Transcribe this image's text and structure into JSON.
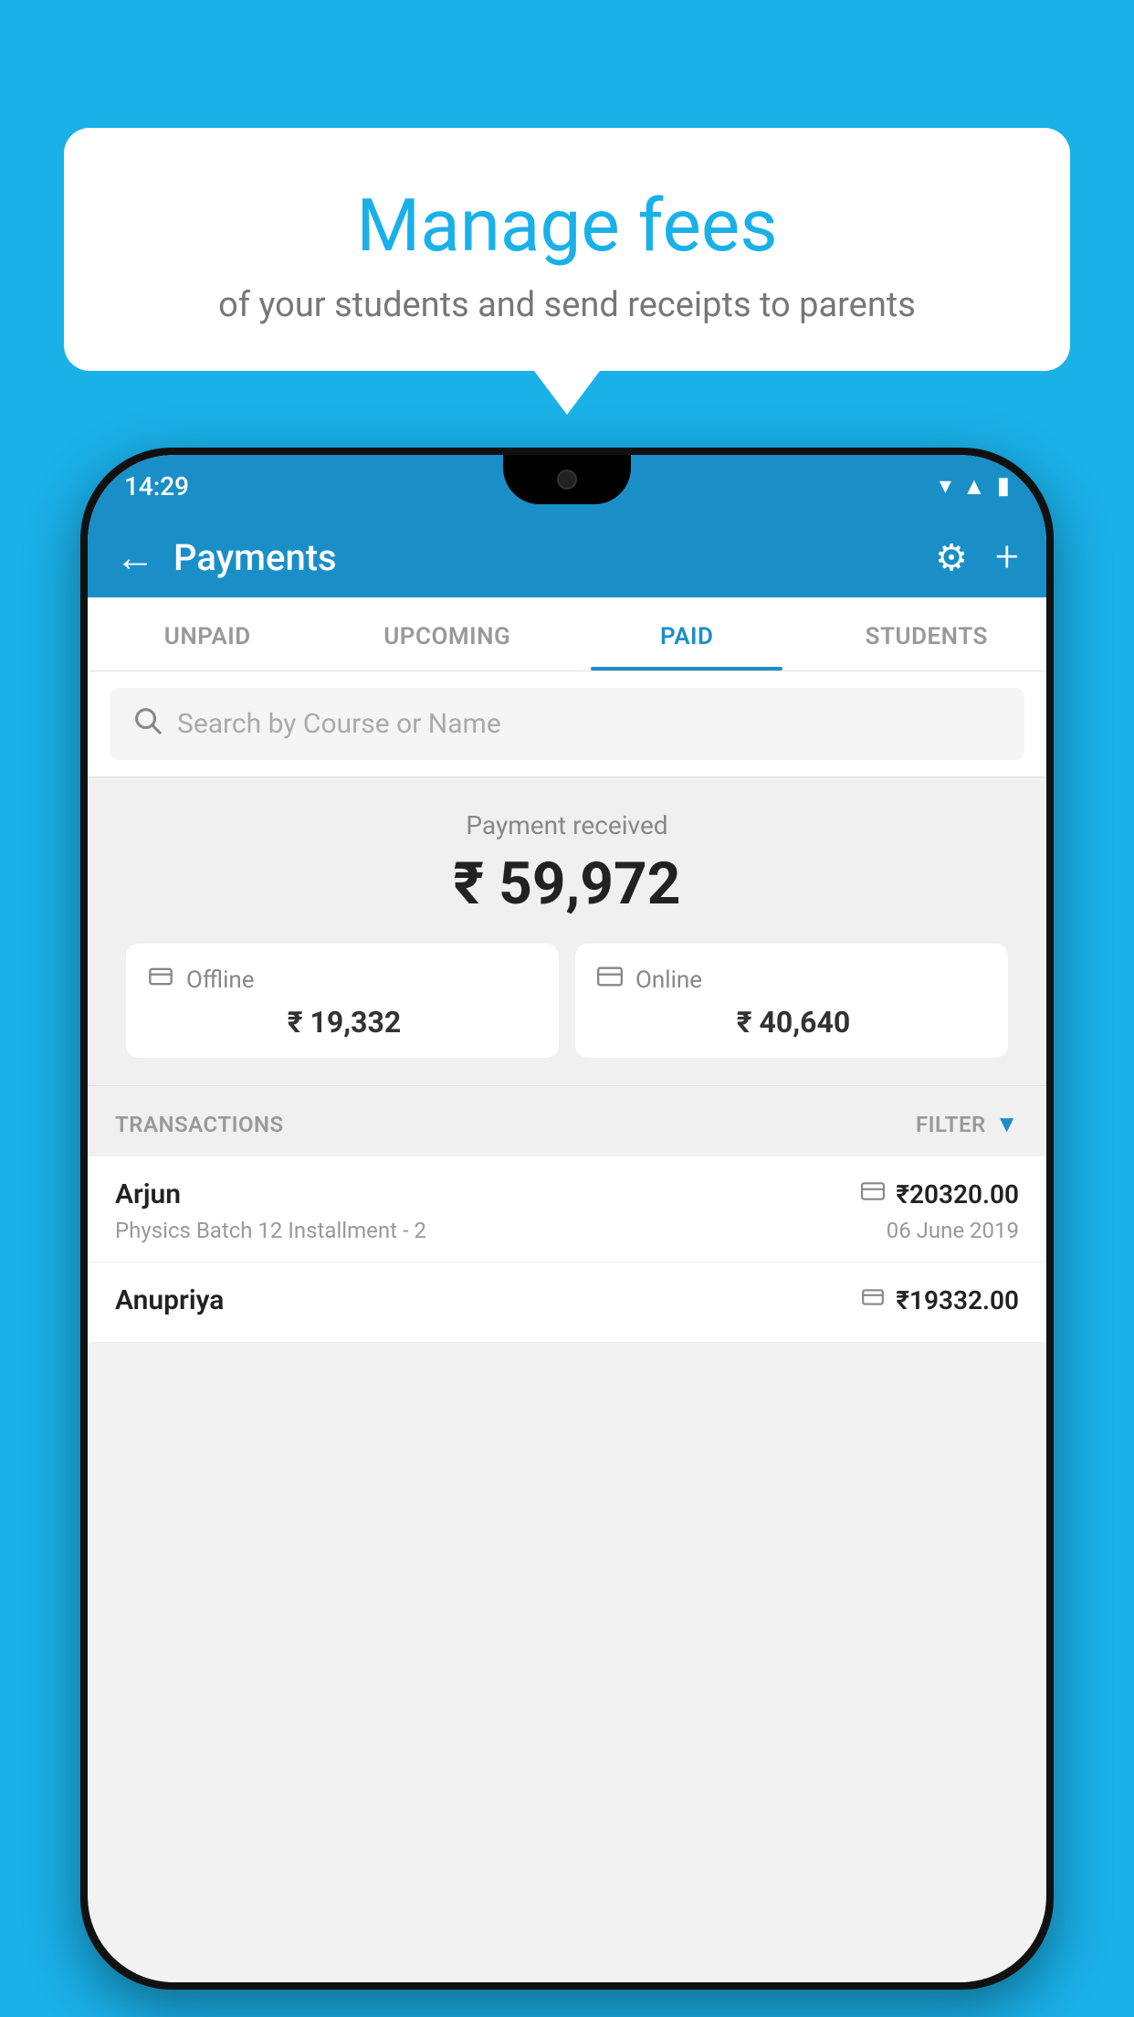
{
  "background_color": "#1ab0e8",
  "speech_bubble": {
    "title": "Manage fees",
    "subtitle": "of your students and send receipts to parents"
  },
  "status_bar": {
    "time": "14:29",
    "icons": [
      "wifi",
      "signal",
      "battery"
    ]
  },
  "top_bar": {
    "back_label": "←",
    "title": "Payments",
    "gear_label": "⚙",
    "plus_label": "+"
  },
  "tabs": [
    {
      "label": "UNPAID",
      "active": false
    },
    {
      "label": "UPCOMING",
      "active": false
    },
    {
      "label": "PAID",
      "active": true
    },
    {
      "label": "STUDENTS",
      "active": false
    }
  ],
  "search": {
    "placeholder": "Search by Course or Name"
  },
  "payment_summary": {
    "label": "Payment received",
    "amount": "₹ 59,972",
    "offline": {
      "icon": "💳",
      "label": "Offline",
      "amount": "₹ 19,332"
    },
    "online": {
      "icon": "💳",
      "label": "Online",
      "amount": "₹ 40,640"
    }
  },
  "transactions": {
    "label": "TRANSACTIONS",
    "filter_label": "FILTER",
    "rows": [
      {
        "name": "Arjun",
        "detail": "Physics Batch 12 Installment - 2",
        "amount": "₹20320.00",
        "date": "06 June 2019",
        "payment_type": "online"
      },
      {
        "name": "Anupriya",
        "detail": "",
        "amount": "₹19332.00",
        "date": "",
        "payment_type": "offline"
      }
    ]
  }
}
